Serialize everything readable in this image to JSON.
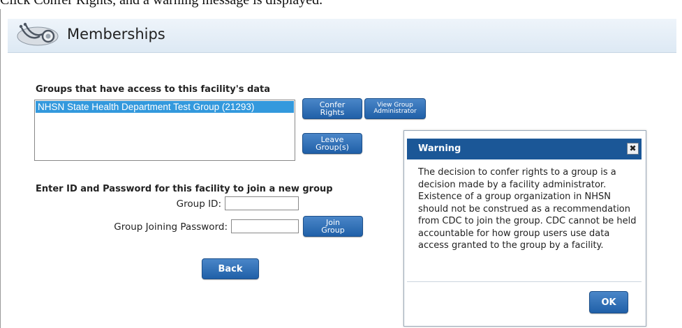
{
  "top_text": "Click Confer Rights, and a warning message is displayed.",
  "header": {
    "title": "Memberships",
    "icon": "stethoscope-icon"
  },
  "groups": {
    "label": "Groups that have access to this facility's data",
    "items": [
      "NHSN State Health Department Test Group (21293)"
    ]
  },
  "buttons": {
    "confer_line1": "Confer",
    "confer_line2": "Rights",
    "view_admin_line1": "View Group",
    "view_admin_line2": "Administrator",
    "leave_line1": "Leave",
    "leave_line2": "Group(s)",
    "join_line1": "Join",
    "join_line2": "Group",
    "back": "Back"
  },
  "join": {
    "label": "Enter ID and Password for this facility to join a new group",
    "group_id_label": "Group ID:",
    "group_id_value": "",
    "password_label": "Group Joining Password:",
    "password_value": ""
  },
  "dialog": {
    "title": "Warning",
    "close_glyph": "✖",
    "body": "The decision to confer rights to a group is a decision made by a facility administrator. Existence of a group organization in NHSN should not be construed as a recommendation from CDC to join the group. CDC cannot be held accountable for how group users use data access granted to the group by a facility.",
    "ok": "OK"
  },
  "colors": {
    "button": "#2a66aa",
    "dialog_title": "#1b5797",
    "selection": "#3399dd"
  }
}
